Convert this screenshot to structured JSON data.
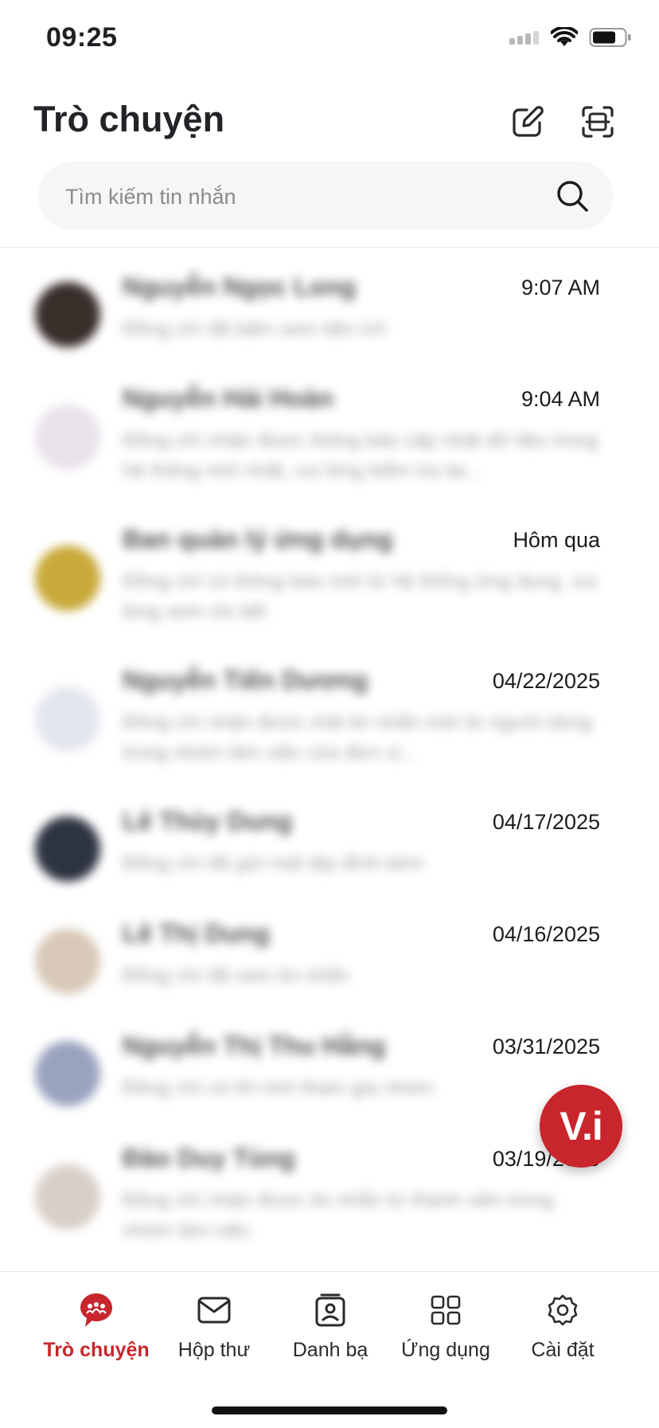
{
  "status_bar": {
    "time": "09:25"
  },
  "header": {
    "title": "Trò chuyện",
    "compose_icon": "compose-icon",
    "scan_icon": "scan-icon"
  },
  "search": {
    "placeholder": "Tìm kiếm tin nhắn",
    "icon": "search-icon"
  },
  "conversations": [
    {
      "name": "Nguyễn Ngọc Long",
      "preview": "Đồng chí đã bấm xem tiện ích",
      "time": "9:07 AM",
      "avatar_color": "#3a2e2b"
    },
    {
      "name": "Nguyễn Hải Hoàn",
      "preview": "Đồng chí nhận được thông báo cập nhật dữ liệu trong hệ thống mới nhất, vui lòng kiểm tra lại...",
      "time": "9:04 AM",
      "avatar_color": "#e8e2ea"
    },
    {
      "name": "Ban quản lý ứng dụng",
      "preview": "Đồng chí có thông báo mới từ hệ thống ứng dụng, vui lòng xem chi tiết",
      "time": "Hôm qua",
      "avatar_color": "#c9a93b"
    },
    {
      "name": "Nguyễn Tiến Dương",
      "preview": "Đồng chí nhận được một tin nhắn mới từ người dùng trong nhóm làm việc của đơn vị...",
      "time": "04/22/2025",
      "avatar_color": "#e4e6ee"
    },
    {
      "name": "Lê Thùy Dung",
      "preview": "Đồng chí đã gửi một tệp đính kèm",
      "time": "04/17/2025",
      "avatar_color": "#2d3340"
    },
    {
      "name": "Lê Thị Dung",
      "preview": "Đồng chí đã xem tin nhắn",
      "time": "04/16/2025",
      "avatar_color": "#d8c8b8"
    },
    {
      "name": "Nguyễn Thị Thu Hằng",
      "preview": "Đồng chí có lời mời tham gia nhóm",
      "time": "03/31/2025",
      "avatar_color": "#9aa3be"
    },
    {
      "name": "Đào Duy Tùng",
      "preview": "Đồng chí nhận được tin nhắn từ thành viên trong nhóm làm việc",
      "time": "03/19/2025",
      "avatar_color": "#d8cfc8"
    }
  ],
  "fab": {
    "label": "V.i"
  },
  "tabbar": {
    "tabs": [
      {
        "label": "Trò chuyện",
        "icon": "chat-bubble-icon",
        "active": true
      },
      {
        "label": "Hộp thư",
        "icon": "mail-icon",
        "active": false
      },
      {
        "label": "Danh bạ",
        "icon": "contacts-icon",
        "active": false
      },
      {
        "label": "Ứng dụng",
        "icon": "apps-grid-icon",
        "active": false
      },
      {
        "label": "Cài đặt",
        "icon": "gear-icon",
        "active": false
      }
    ]
  },
  "colors": {
    "accent": "#c8262c",
    "search_bg": "#f6f6f7",
    "text": "#232328"
  }
}
